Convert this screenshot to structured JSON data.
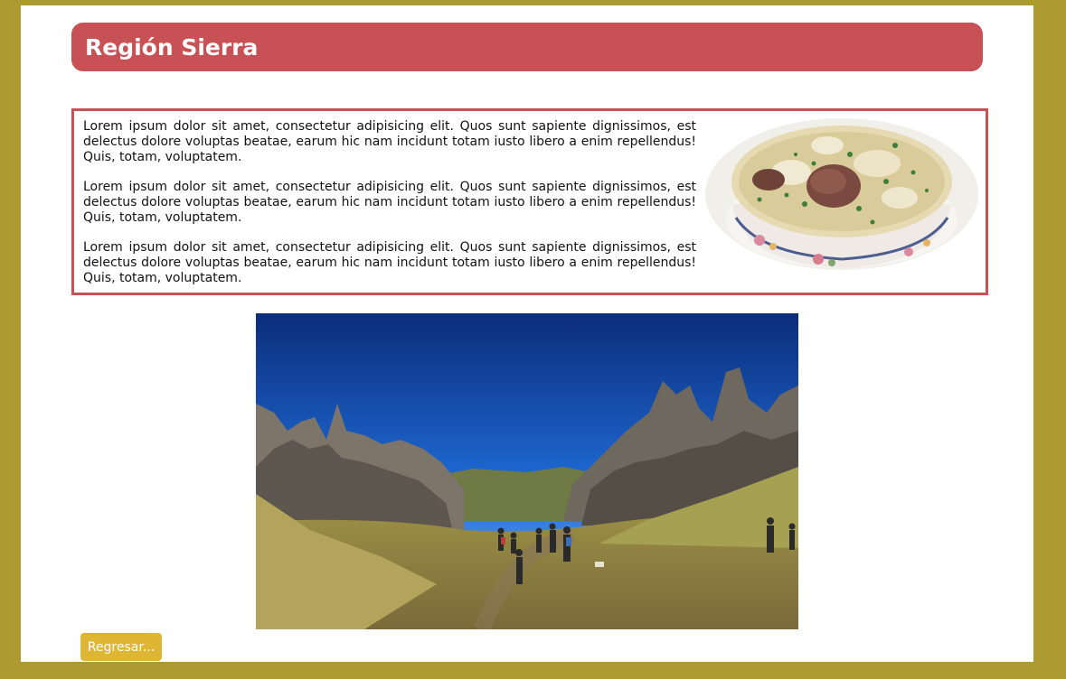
{
  "header": {
    "title": "Región Sierra"
  },
  "content": {
    "paragraphs": [
      "Lorem ipsum dolor sit amet, consectetur adipisicing elit. Quos sunt sapiente dignissimos, est delectus dolore voluptas beatae, earum hic nam incidunt totam iusto libero a enim repellendus! Quis, totam, voluptatem.",
      "Lorem ipsum dolor sit amet, consectetur adipisicing elit. Quos sunt sapiente dignissimos, est delectus dolore voluptas beatae, earum hic nam incidunt totam iusto libero a enim repellendus! Quis, totam, voluptatem.",
      "Lorem ipsum dolor sit amet, consectetur adipisicing elit. Quos sunt sapiente dignissimos, est delectus dolore voluptas beatae, earum hic nam incidunt totam iusto libero a enim repellendus! Quis, totam, voluptatem."
    ],
    "soup_image": "soup-bowl-image"
  },
  "landscape_image": "andean-rock-formations-image",
  "back_button": {
    "label": "Regresar..."
  },
  "colors": {
    "outer_background": "#ad9a31",
    "page_background": "#ffffff",
    "header_background": "#c85155",
    "box_border": "#c85155",
    "button_background": "#dfb633"
  }
}
